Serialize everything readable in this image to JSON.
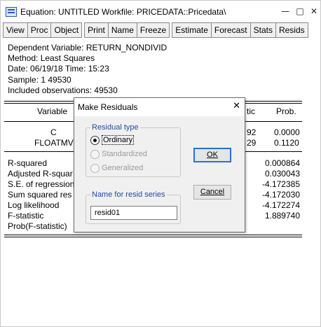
{
  "window": {
    "title": "Equation: UNTITLED   Workfile: PRICEDATA::Pricedata\\",
    "minimize": "—",
    "maximize": "□",
    "close": "✕"
  },
  "toolbar": {
    "view": "View",
    "proc": "Proc",
    "object": "Object",
    "print": "Print",
    "name": "Name",
    "freeze": "Freeze",
    "estimate": "Estimate",
    "forecast": "Forecast",
    "stats": "Stats",
    "resids": "Resids"
  },
  "output": {
    "header_lines": [
      "Dependent Variable: RETURN_NONDIVID",
      "Method: Least Squares",
      "Date: 06/19/18   Time: 15:23",
      "Sample: 1 49530",
      "Included observations: 49530"
    ],
    "columns": {
      "variable": "Variable",
      "tstat_partial": "tic",
      "prob": "Prob."
    },
    "rows": [
      {
        "variable": "C",
        "tstat_partial": "92",
        "prob": "0.0000"
      },
      {
        "variable": "FLOATMV",
        "tstat_partial": "29",
        "prob": "0.1120"
      }
    ],
    "stats": [
      {
        "label": "R-squared",
        "value": "0.000864"
      },
      {
        "label": "Adjusted R-squar",
        "value": "0.030043"
      },
      {
        "label": "S.E. of regression",
        "value": "-4.172385"
      },
      {
        "label": "Sum squared res",
        "value": "-4.172030"
      },
      {
        "label": "Log likelihood",
        "value": "-4.172274"
      },
      {
        "label": "F-statistic",
        "value": "1.889740"
      },
      {
        "label": "Prob(F-statistic)",
        "value": ""
      }
    ]
  },
  "dialog": {
    "title": "Make Residuals",
    "close": "✕",
    "residual_type": {
      "title": "Residual type",
      "options": [
        {
          "label": "Ordinary",
          "checked": true,
          "disabled": false
        },
        {
          "label": "Standardized",
          "checked": false,
          "disabled": true
        },
        {
          "label": "Generalized",
          "checked": false,
          "disabled": true
        }
      ]
    },
    "name_group": {
      "title": "Name for resid series",
      "value": "resid01"
    },
    "ok_label": "OK",
    "cancel_label": "Cancel"
  }
}
